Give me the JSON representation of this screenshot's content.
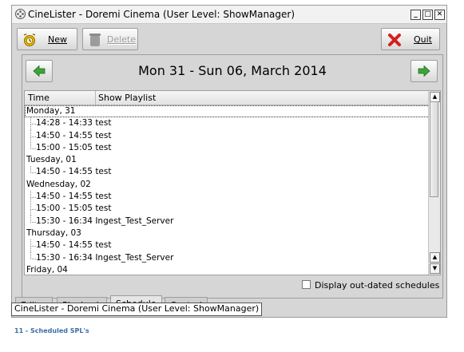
{
  "window": {
    "title": "CineLister - Doremi Cinema (User Level: ShowManager)"
  },
  "toolbar": {
    "new_label": "New",
    "delete_label": "Delete",
    "quit_label": "Quit"
  },
  "schedule": {
    "date_range": "Mon 31 - Sun 06, March 2014",
    "columns": [
      "Time",
      "Show Playlist"
    ],
    "days": [
      {
        "label": "Monday, 31",
        "entries": [
          "14:28 - 14:33 test",
          "14:50 - 14:55 test",
          "15:00 - 15:05 test"
        ]
      },
      {
        "label": "Tuesday, 01",
        "entries": [
          "14:50 - 14:55 test"
        ]
      },
      {
        "label": "Wednesday, 02",
        "entries": [
          "14:50 - 14:55 test",
          "15:00 - 15:05 test",
          "15:30 - 16:34 Ingest_Test_Server"
        ]
      },
      {
        "label": "Thursday, 03",
        "entries": [
          "14:50 - 14:55 test",
          "15:30 - 16:34 Ingest_Test_Server"
        ]
      },
      {
        "label": "Friday, 04",
        "entries": []
      }
    ],
    "outdated_label": "Display out-dated schedules",
    "outdated_checked": false
  },
  "tabs": [
    "Editor",
    "Playback",
    "Schedule",
    "Control"
  ],
  "tooltip": "CineLister - Doremi Cinema (User Level: ShowManager)",
  "caption": "11 - Scheduled SPL's",
  "colors": {
    "prev_arrow": "#3aa63a",
    "next_arrow": "#3aa63a",
    "quit_icon": "#d42020",
    "caption": "#3b6ea5"
  }
}
